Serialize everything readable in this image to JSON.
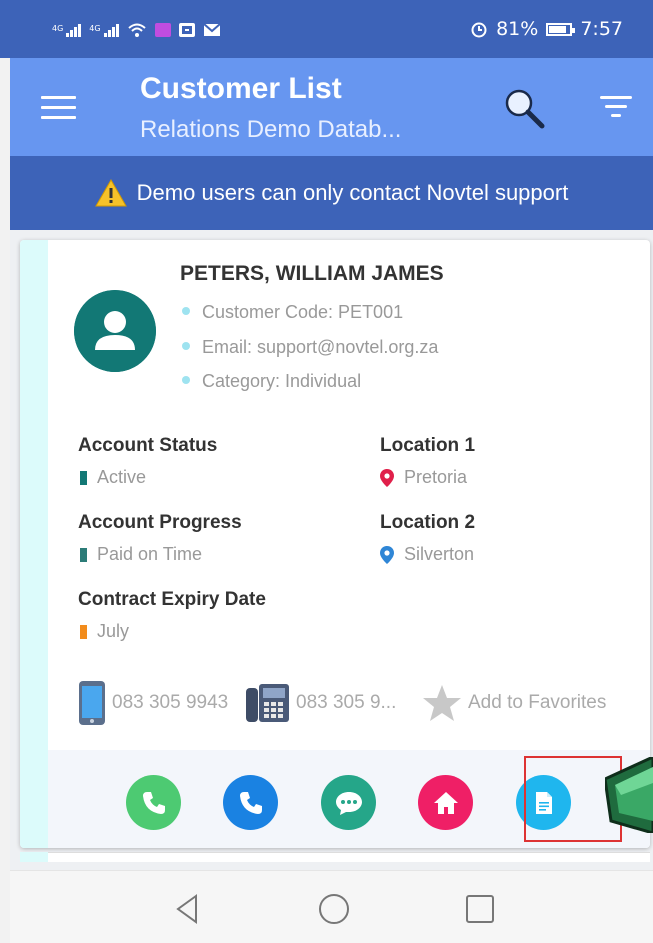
{
  "status_bar": {
    "signal1_label": "4G",
    "signal2_label": "4G",
    "battery_pct": "81%",
    "time": "7:57",
    "icons": [
      "wifi-icon",
      "messenger-icon",
      "facebook-icon",
      "mail-icon",
      "alarm-icon",
      "battery-icon"
    ]
  },
  "app_bar": {
    "title": "Customer List",
    "subtitle": "Relations Demo Datab...",
    "icons": [
      "menu-icon",
      "search-icon",
      "filter-icon"
    ]
  },
  "banner": {
    "text": "Demo users can only contact Novtel support",
    "icon": "warning-icon"
  },
  "customer": {
    "name": "PETERS, WILLIAM JAMES",
    "code": "Customer Code: PET001",
    "email": "Email: support@novtel.org.za",
    "category": "Category: Individual",
    "fields": {
      "account_status": {
        "label": "Account Status",
        "value": "Active",
        "color": "#127875"
      },
      "location1": {
        "label": "Location 1",
        "value": "Pretoria",
        "color": "#e0204a"
      },
      "account_progress": {
        "label": "Account Progress",
        "value": "Paid on Time",
        "color": "#127875"
      },
      "location2": {
        "label": "Location 2",
        "value": "Silverton",
        "color": "#2f86d6"
      },
      "contract_expiry": {
        "label": "Contract Expiry Date",
        "value": "July",
        "color": "#f28c1c"
      }
    },
    "mobile": "083 305 9943",
    "landline": "083 305 9...",
    "favorites_label": "Add to Favorites"
  },
  "actions": [
    {
      "name": "call-mobile-button",
      "icon": "phone-icon",
      "color": "#4dca72"
    },
    {
      "name": "call-landline-button",
      "icon": "phone-icon",
      "color": "#1a82e2"
    },
    {
      "name": "message-button",
      "icon": "chat-icon",
      "color": "#25a689"
    },
    {
      "name": "home-button",
      "icon": "home-icon",
      "color": "#ef1f66"
    },
    {
      "name": "document-button",
      "icon": "document-icon",
      "color": "#1fb6ee"
    }
  ],
  "nav_bar": {
    "icons": [
      "back-icon",
      "home-circle-icon",
      "recents-icon"
    ]
  }
}
